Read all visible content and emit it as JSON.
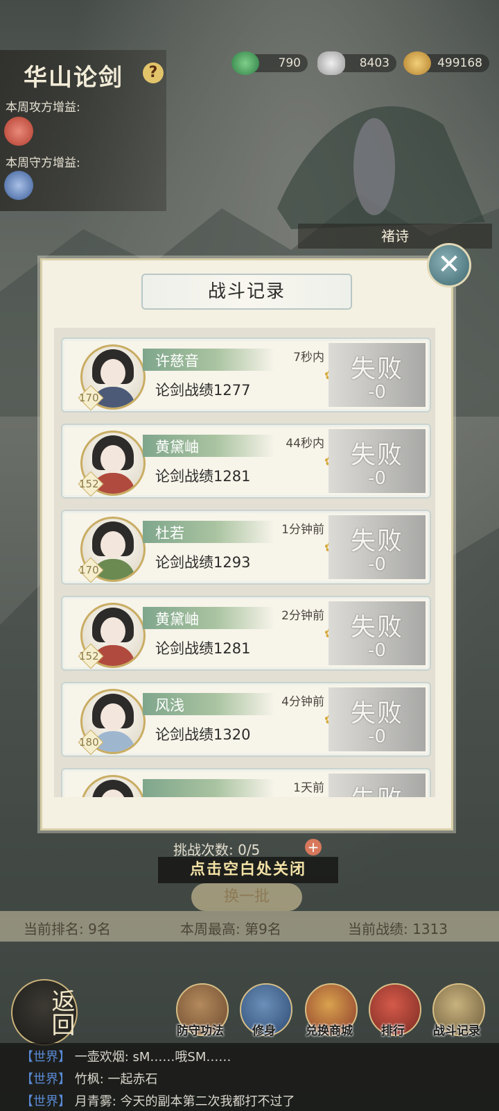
{
  "header": {
    "title": "华山论剑",
    "help_icon": "?",
    "attack_buff_label": "本周攻方增益:",
    "defense_buff_label": "本周守方增益:"
  },
  "resources": [
    {
      "icon": "jade-icon",
      "value": "790"
    },
    {
      "icon": "silver-ingot-icon",
      "value": "8403"
    },
    {
      "icon": "coins-icon",
      "value": "499168"
    }
  ],
  "npc": {
    "name": "褚诗"
  },
  "modal": {
    "title": "战斗记录",
    "close_icon": "✕",
    "records": [
      {
        "name": "许慈音",
        "level": "170",
        "score": "论剑战绩1277",
        "time": "7秒内",
        "result": "失败",
        "delta": "-0",
        "dress": "#4c5a78"
      },
      {
        "name": "黄黛岫",
        "level": "152",
        "score": "论剑战绩1281",
        "time": "44秒内",
        "result": "失败",
        "delta": "-0",
        "dress": "#b14a3e"
      },
      {
        "name": "杜若",
        "level": "170",
        "score": "论剑战绩1293",
        "time": "1分钟前",
        "result": "失败",
        "delta": "-0",
        "dress": "#6b8a52"
      },
      {
        "name": "黄黛岫",
        "level": "152",
        "score": "论剑战绩1281",
        "time": "2分钟前",
        "result": "失败",
        "delta": "-0",
        "dress": "#b14a3e"
      },
      {
        "name": "风浅",
        "level": "180",
        "score": "论剑战绩1320",
        "time": "4分钟前",
        "result": "失败",
        "delta": "-0",
        "dress": "#9fb6cf"
      },
      {
        "name": "",
        "level": "",
        "score": "",
        "time": "1天前",
        "result": "失败",
        "delta": "",
        "dress": "#555"
      }
    ]
  },
  "bottom": {
    "attempts": "挑战次数: 0/5",
    "tap_close": "点击空白处关闭",
    "refresh": "换一批",
    "rank": "当前排名: 9名",
    "weekly_best": "本周最高: 第9名",
    "current_score": "当前战绩: 1313"
  },
  "nav": {
    "back": "返回",
    "items": [
      "防守功法",
      "修身",
      "兑换商城",
      "排行",
      "战斗记录"
    ]
  },
  "chat": [
    {
      "channel": "【世界】",
      "text": "一壶欢烟: sM……哦SM……"
    },
    {
      "channel": "【世界】",
      "text": "竹枫: 一起赤石"
    },
    {
      "channel": "【世界】",
      "text": "月青雾: 今天的副本第二次我都打不过了"
    }
  ]
}
